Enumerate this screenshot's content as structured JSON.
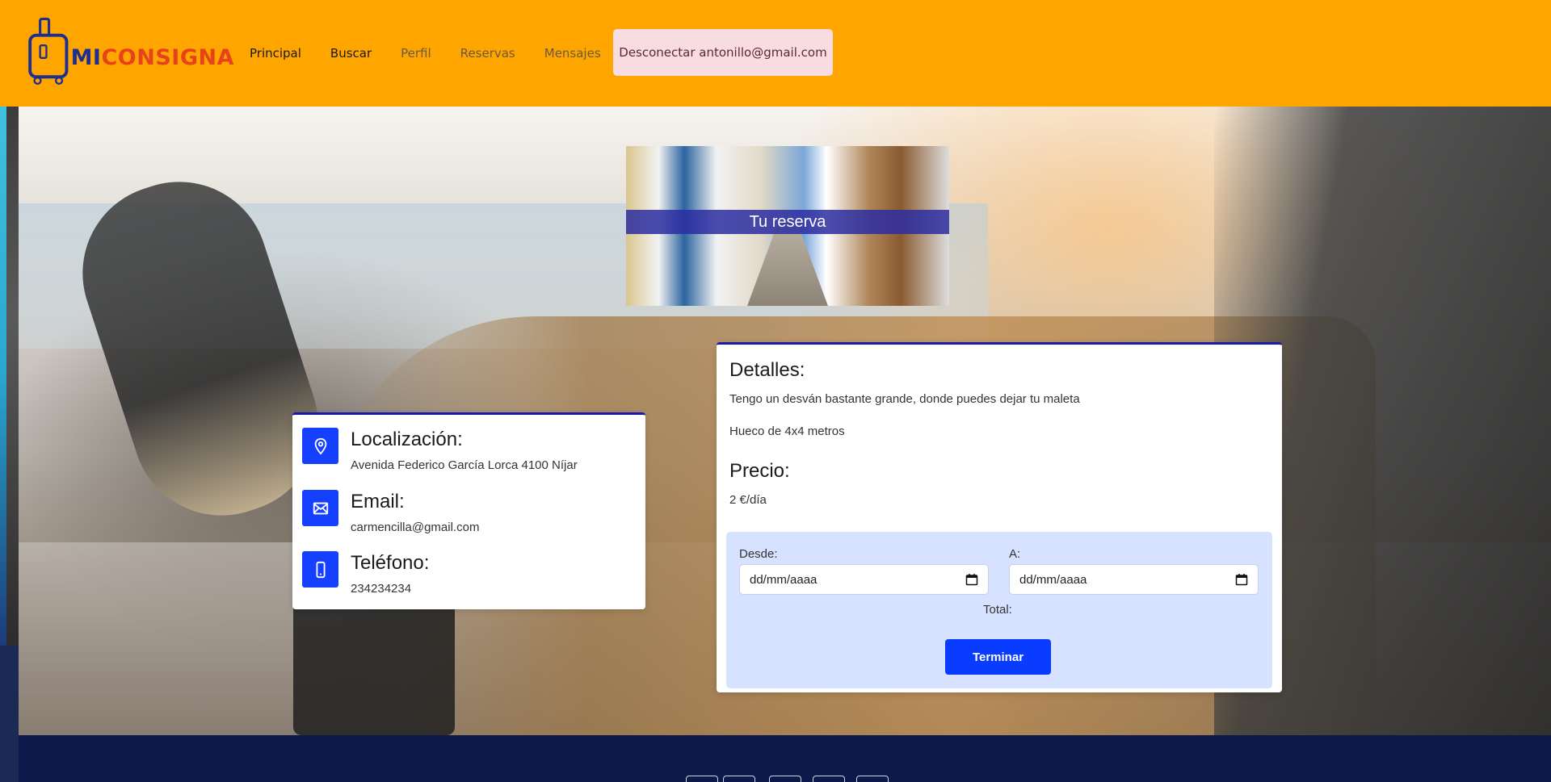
{
  "brand": {
    "logo_part1": "MI",
    "logo_part2": "CONSIGNA",
    "primary_color": "#ffa500",
    "accent_blue": "#0a3cff"
  },
  "nav": {
    "principal": "Principal",
    "buscar": "Buscar",
    "perfil": "Perfil",
    "reservas": "Reservas",
    "mensajes": "Mensajes",
    "logout": "Desconectar antonillo@gmail.com"
  },
  "banner": {
    "title": "Tu reserva"
  },
  "contact": {
    "location_label": "Localización:",
    "location_value": "Avenida Federico García Lorca 4100 Níjar",
    "email_label": "Email:",
    "email_value": "carmencilla@gmail.com",
    "phone_label": "Teléfono:",
    "phone_value": "234234234"
  },
  "details": {
    "title": "Detalles:",
    "description": "Tengo un desván bastante grande, donde puedes dejar tu maleta",
    "size": "Hueco de 4x4 metros",
    "price_label": "Precio:",
    "price_value": "2 €/día"
  },
  "booking": {
    "from_label": "Desde:",
    "from_placeholder": "dd/mm/aaaa",
    "to_label": "A:",
    "to_placeholder": "dd/mm/aaaa",
    "total_label": "Total:",
    "submit_label": "Terminar"
  },
  "icons": {
    "location": "location-pin-icon",
    "email": "envelope-icon",
    "phone": "phone-icon",
    "calendar": "calendar-icon"
  }
}
